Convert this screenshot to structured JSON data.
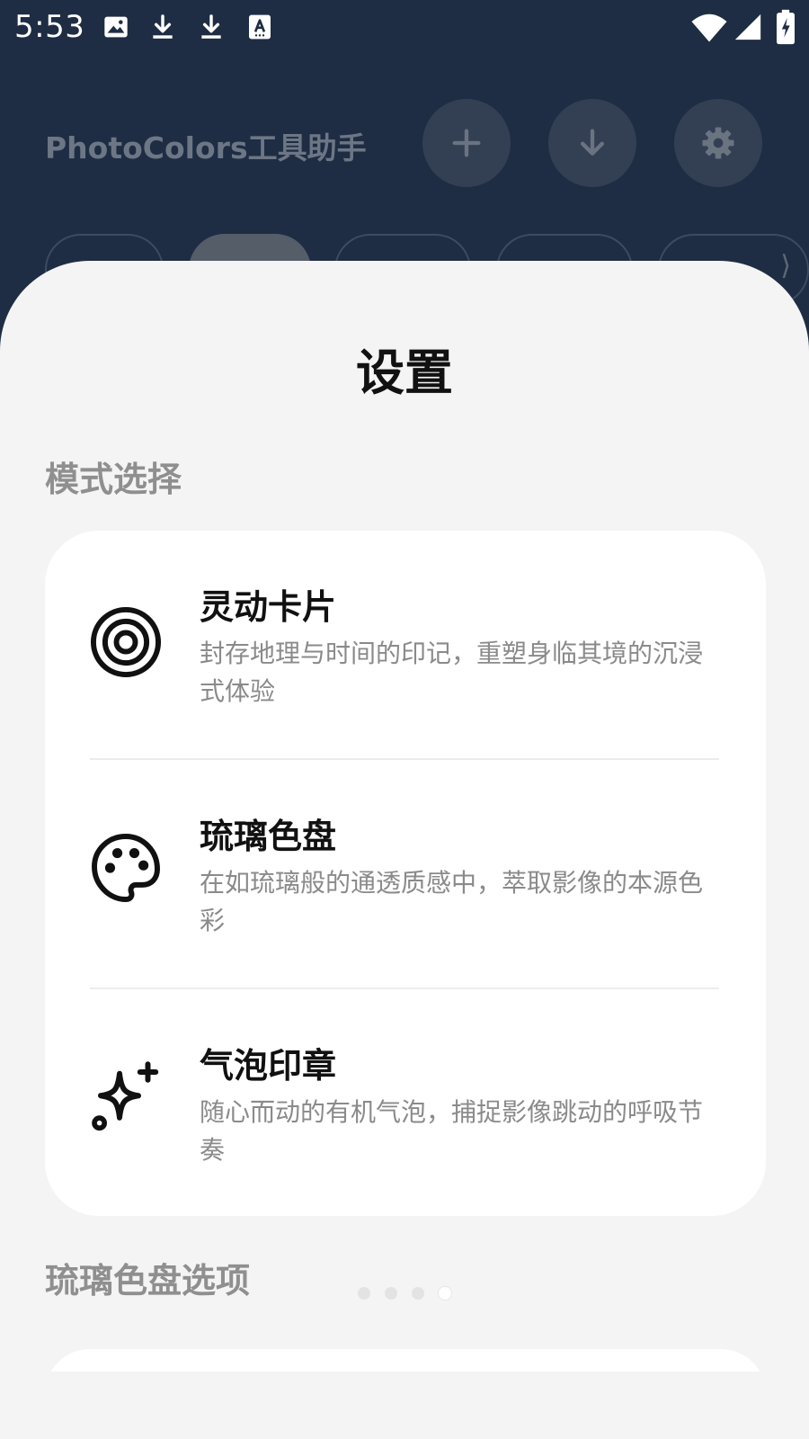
{
  "status_bar": {
    "time": "5:53",
    "left_icons": [
      "image-icon",
      "download-icon",
      "download-icon",
      "font-icon"
    ],
    "right_icons": [
      "wifi-icon",
      "signal-icon",
      "battery-charging-icon"
    ]
  },
  "header": {
    "title": "PhotoColors工具助手",
    "buttons": [
      "plus-icon",
      "arrow-down-icon",
      "gear-icon"
    ]
  },
  "sheet": {
    "title": "设置",
    "mode_section_label": "模式选择",
    "modes": [
      {
        "icon": "target-icon",
        "title": "灵动卡片",
        "description": "封存地理与时间的印记，重塑身临其境的沉浸式体验"
      },
      {
        "icon": "palette-icon",
        "title": "琉璃色盘",
        "description": "在如琉璃般的通透质感中，萃取影像的本源色彩"
      },
      {
        "icon": "sparkle-icon",
        "title": "气泡印章",
        "description": "随心而动的有机气泡，捕捉影像跳动的呼吸节奏"
      }
    ],
    "options_section_label": "琉璃色盘选项",
    "page_indicator": {
      "count": 4,
      "active_index": 3
    }
  },
  "colors": {
    "background_dark": "#1e2d44",
    "sheet_background": "#f4f4f4",
    "card_background": "#ffffff",
    "title_text": "#111111",
    "secondary_text": "#8a8a8a",
    "section_label": "#8f8f8f"
  }
}
